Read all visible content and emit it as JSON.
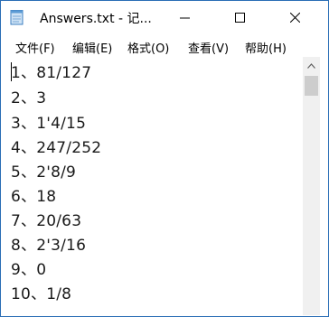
{
  "window": {
    "title": "Answers.txt - 记..."
  },
  "menu": [
    {
      "label": "文件(F)",
      "name": "menu-file"
    },
    {
      "label": "编辑(E)",
      "name": "menu-edit"
    },
    {
      "label": "格式(O)",
      "name": "menu-format"
    },
    {
      "label": "查看(V)",
      "name": "menu-view"
    },
    {
      "label": "帮助(H)",
      "name": "menu-help"
    }
  ],
  "lines": [
    "1、81/127",
    "2、3",
    "3、1'4/15",
    "4、247/252",
    "5、2'8/9",
    "6、18",
    "7、20/63",
    "8、2'3/16",
    "9、0",
    "10、1/8"
  ],
  "icons": {
    "app": "notepad-icon",
    "minimize": "minimize-icon",
    "maximize": "maximize-icon",
    "close": "close-icon",
    "scroll_up": "chevron-up-icon"
  }
}
